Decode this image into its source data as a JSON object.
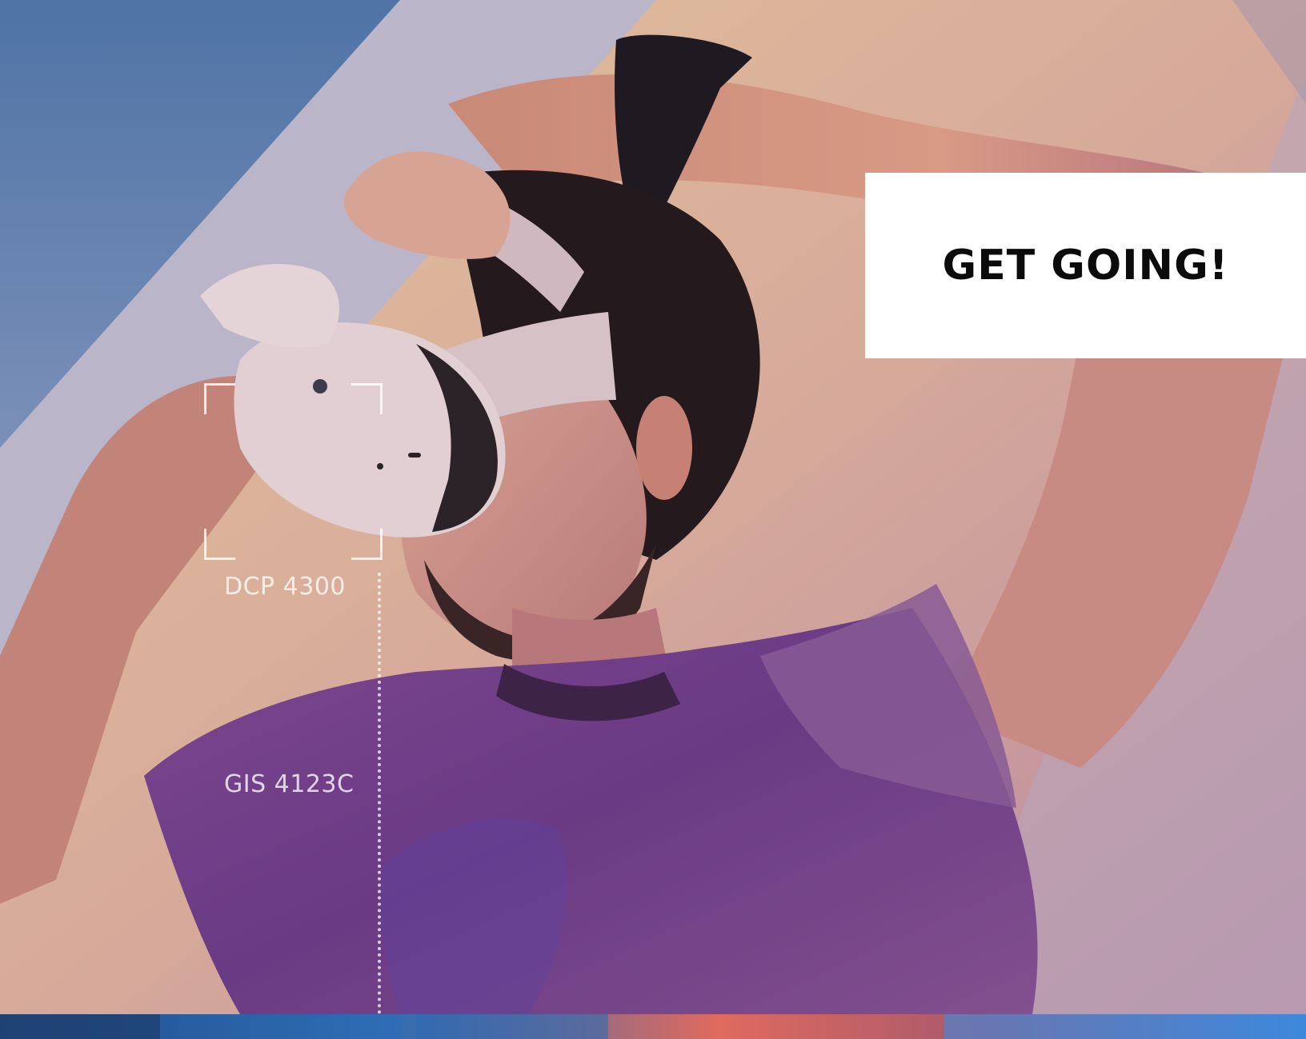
{
  "hero": {
    "image": "person-wearing-vr-headset-photo",
    "colors": {
      "blue_band": "#5b7fae",
      "lavender_band": "#b9b6cf",
      "peach_band": "#d9b98f",
      "shirt_purple": "#6b3f84"
    }
  },
  "cta": {
    "label": "GET GOING!",
    "background": "#ffffff"
  },
  "course_codes": [
    {
      "label": "DCP 4300"
    },
    {
      "label": "GIS 4123C"
    }
  ],
  "overlay": {
    "focus_bracket_icon": "focus-bracket-icon"
  }
}
